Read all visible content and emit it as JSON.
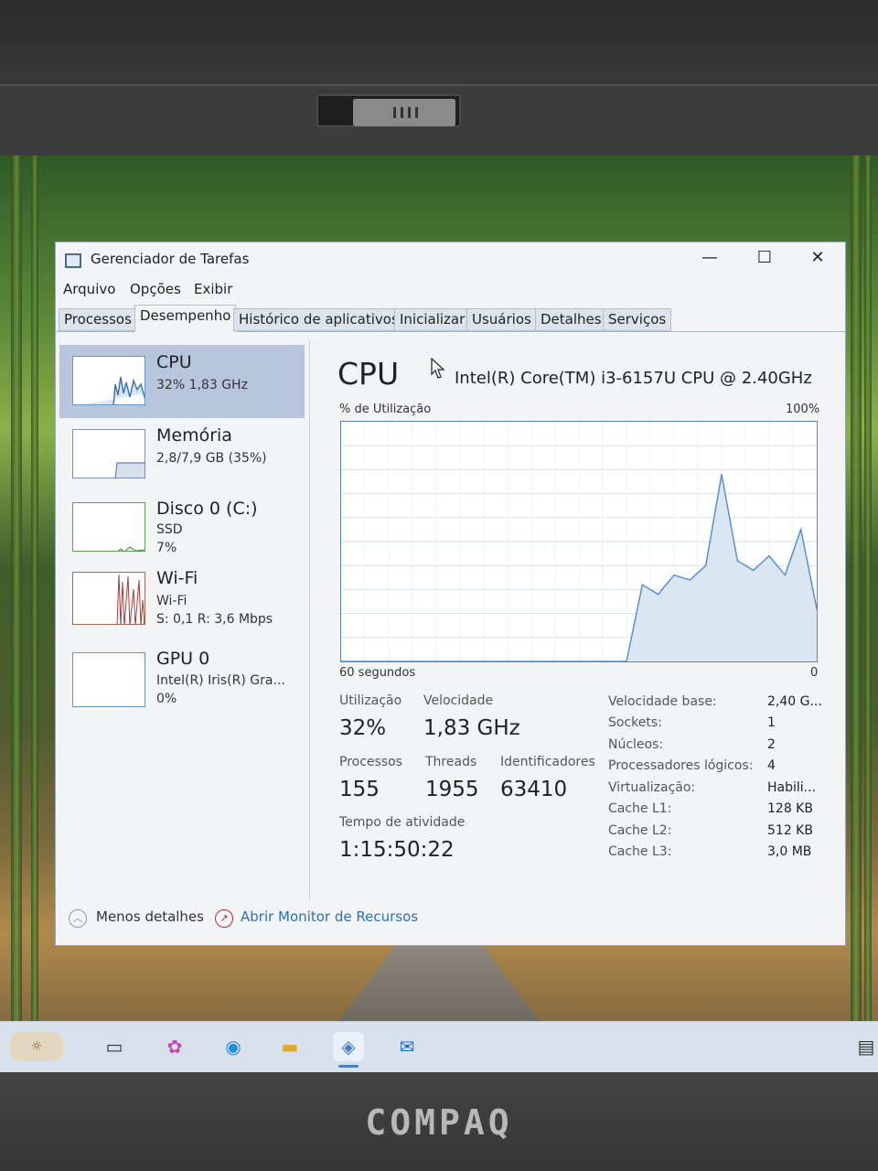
{
  "window": {
    "title": "Gerenciador de Tarefas",
    "controls": {
      "minimize": "—",
      "maximize": "☐",
      "close": "✕"
    }
  },
  "menu": [
    "Arquivo",
    "Opções",
    "Exibir"
  ],
  "tabs": [
    "Processos",
    "Desempenho",
    "Histórico de aplicativos",
    "Inicializar",
    "Usuários",
    "Detalhes",
    "Serviços"
  ],
  "active_tab": "Desempenho",
  "sidebar": [
    {
      "title": "CPU",
      "line1": "32% 1,83 GHz",
      "line2": "",
      "line3": ""
    },
    {
      "title": "Memória",
      "line1": "2,8/7,9 GB (35%)",
      "line2": "",
      "line3": ""
    },
    {
      "title": "Disco 0 (C:)",
      "line1": "SSD",
      "line2": "7%",
      "line3": ""
    },
    {
      "title": "Wi-Fi",
      "line1": "Wi-Fi",
      "line2": "S: 0,1  R: 3,6 Mbps",
      "line3": ""
    },
    {
      "title": "GPU 0",
      "line1": "Intel(R) Iris(R) Gra...",
      "line2": "0%",
      "line3": ""
    }
  ],
  "cpu": {
    "title": "CPU",
    "model": "Intel(R) Core(TM) i3-6157U CPU @ 2.40GHz",
    "graph_label": "% de Utilização",
    "graph_max": "100%",
    "graph_time": "60 segundos",
    "graph_min": "0",
    "utilization_label": "Utilização",
    "utilization": "32%",
    "speed_label": "Velocidade",
    "speed": "1,83 GHz",
    "processes_label": "Processos",
    "processes": "155",
    "threads_label": "Threads",
    "threads": "1955",
    "handles_label": "Identificadores",
    "handles": "63410",
    "uptime_label": "Tempo de atividade",
    "uptime": "1:15:50:22",
    "specs": [
      {
        "k": "Velocidade base:",
        "v": "2,40 G..."
      },
      {
        "k": "Sockets:",
        "v": "1"
      },
      {
        "k": "Núcleos:",
        "v": "2"
      },
      {
        "k": "Processadores lógicos:",
        "v": "4"
      },
      {
        "k": "Virtualização:",
        "v": "Habili..."
      },
      {
        "k": "Cache L1:",
        "v": "128 KB"
      },
      {
        "k": "Cache L2:",
        "v": "512 KB"
      },
      {
        "k": "Cache L3:",
        "v": "3,0 MB"
      }
    ]
  },
  "chart_data": {
    "type": "area",
    "ylim": [
      0,
      100
    ],
    "x": [
      0,
      2,
      4,
      6,
      8,
      10,
      12,
      14,
      16,
      18,
      20,
      22,
      24,
      26,
      28,
      30,
      32,
      34,
      36,
      38,
      40,
      42,
      44,
      46,
      48,
      50,
      52,
      54,
      56,
      58,
      60
    ],
    "series": [
      {
        "values": [
          0,
          0,
          0,
          0,
          0,
          0,
          0,
          0,
          0,
          0,
          0,
          0,
          0,
          0,
          0,
          0,
          0,
          0,
          0,
          32,
          28,
          36,
          34,
          40,
          78,
          42,
          38,
          44,
          36,
          55,
          22
        ]
      }
    ]
  },
  "footer": {
    "less_details": "Menos detalhes",
    "resource_monitor": "Abrir Monitor de Recursos"
  },
  "brand": "COMPAQ",
  "colors": {
    "graph_line": "#5a8fcf",
    "graph_fill": "#dbe6f3",
    "sidebar_active": "#b7c6dc"
  }
}
